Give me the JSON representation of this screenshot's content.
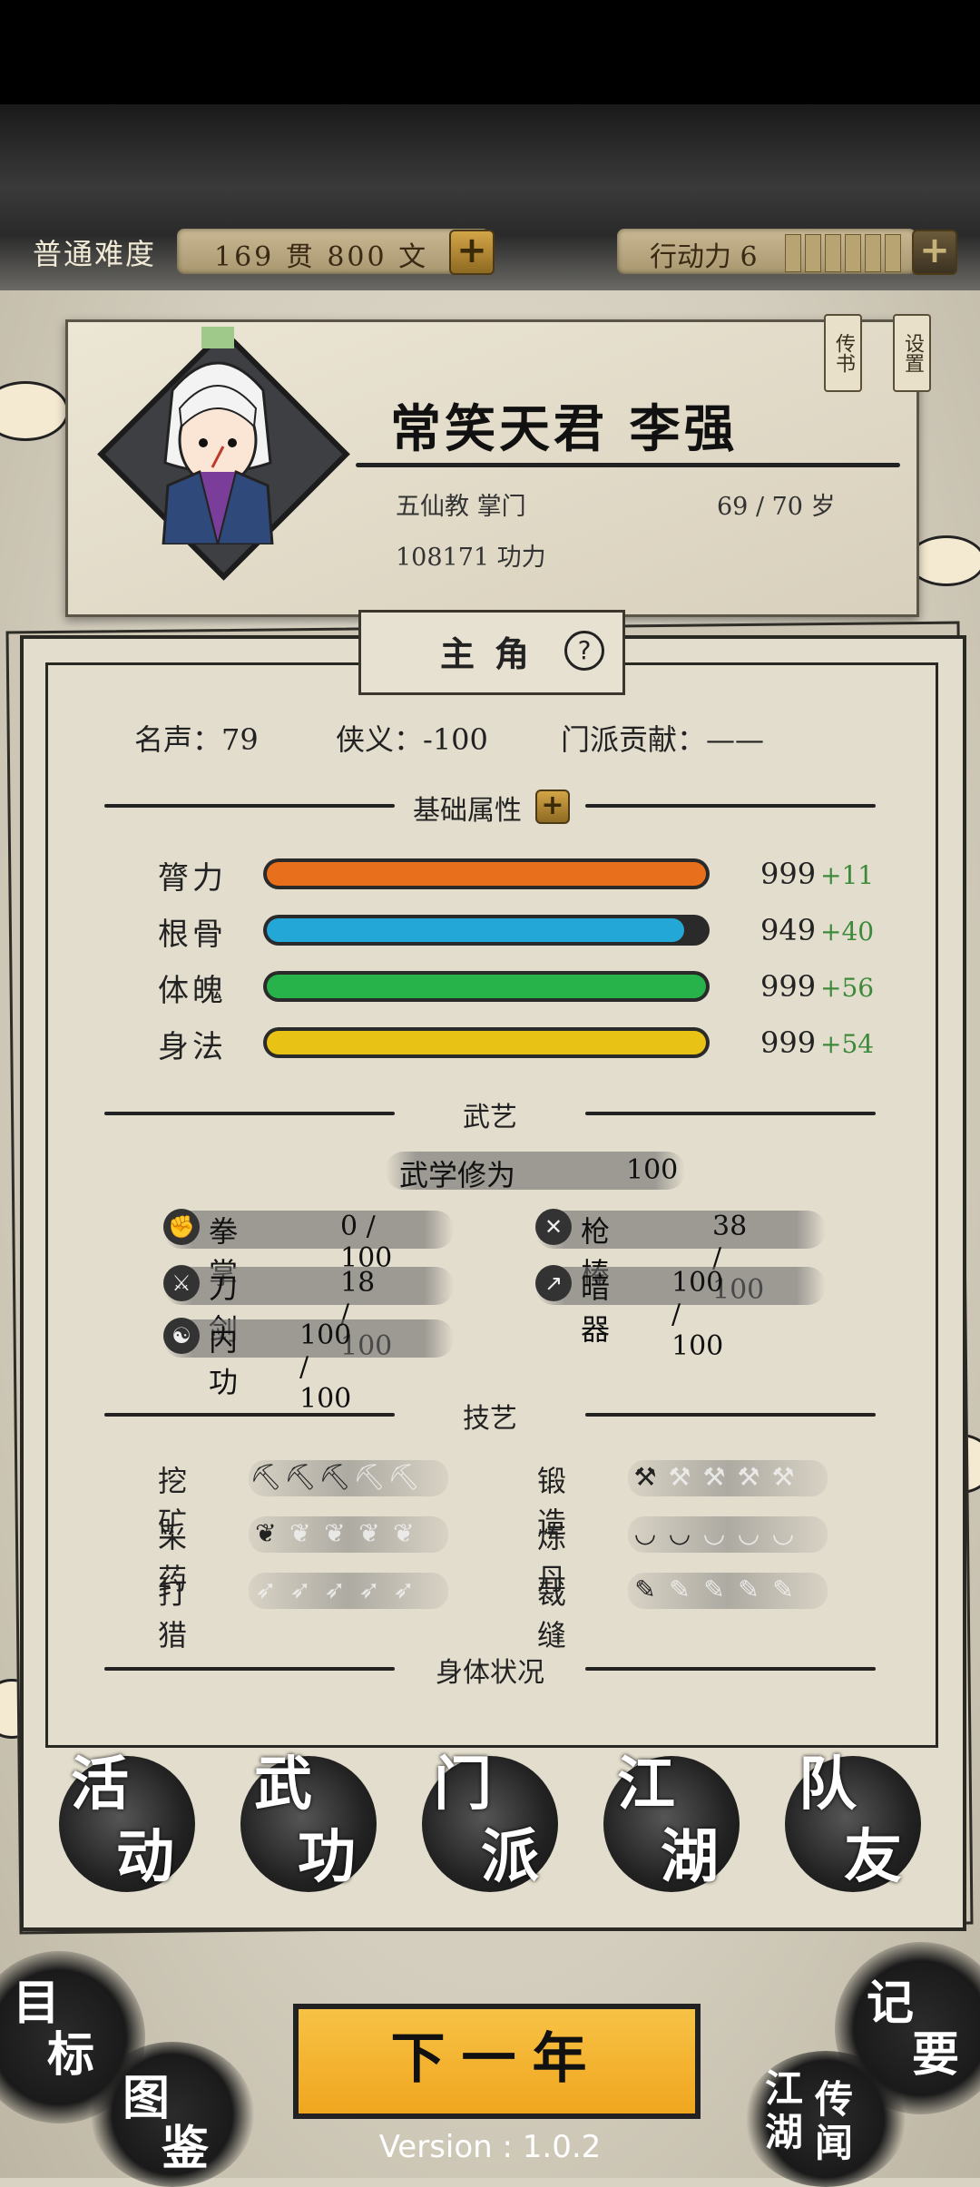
{
  "topbar": {
    "difficulty": "普通难度",
    "money": "169 贯 800 文",
    "action_points": "行动力 6"
  },
  "character": {
    "title_name": "常笑天君 李强",
    "sect_role": "五仙教 掌门",
    "age": "69 / 70 岁",
    "power": "108171 功力"
  },
  "tags": {
    "letter": "传书",
    "settings": "设置"
  },
  "panel": {
    "tab_label": "主角",
    "help_icon": "?",
    "fame": "名声：79",
    "chivalry": "侠义：-100",
    "contribution": "门派贡献：——"
  },
  "sections": {
    "attributes": "基础属性",
    "martial": "武艺",
    "crafts": "技艺",
    "body": "身体状况"
  },
  "attributes": [
    {
      "label": "膂力",
      "value": "999",
      "bonus": "+11",
      "color": "#e8701c",
      "fill": 1.0
    },
    {
      "label": "根骨",
      "value": "949",
      "bonus": "+40",
      "color": "#23a7d6",
      "fill": 0.95
    },
    {
      "label": "体魄",
      "value": "999",
      "bonus": "+56",
      "color": "#27b34a",
      "fill": 1.0
    },
    {
      "label": "身法",
      "value": "999",
      "bonus": "+54",
      "color": "#e8c316",
      "fill": 1.0
    }
  ],
  "martial": {
    "cultivation_label": "武学修为",
    "cultivation_value": "100",
    "skills": [
      {
        "name": "拳掌",
        "value": "0 / 100",
        "icon": "fist-icon"
      },
      {
        "name": "枪棒",
        "value": "38 / 100",
        "icon": "spear-icon"
      },
      {
        "name": "刀剑",
        "value": "18 / 100",
        "icon": "sword-icon"
      },
      {
        "name": "暗器",
        "value": "100 / 100",
        "icon": "dart-icon"
      },
      {
        "name": "内功",
        "value": "100 / 100",
        "icon": "inner-power-icon"
      }
    ]
  },
  "crafts": [
    {
      "name": "挖矿",
      "level": 3,
      "max": 5,
      "icon": "pickaxe-icon"
    },
    {
      "name": "锻造",
      "level": 1,
      "max": 5,
      "icon": "anvil-icon"
    },
    {
      "name": "采药",
      "level": 1,
      "max": 5,
      "icon": "herb-icon"
    },
    {
      "name": "炼丹",
      "level": 2,
      "max": 5,
      "icon": "bowl-icon"
    },
    {
      "name": "打猎",
      "level": 0,
      "max": 5,
      "icon": "bow-icon"
    },
    {
      "name": "裁缝",
      "level": 1,
      "max": 5,
      "icon": "needle-icon"
    }
  ],
  "nav": {
    "activity": "活动",
    "martial": "武功",
    "sect": "门派",
    "jianghu": "江湖",
    "teammates": "队友"
  },
  "bottom": {
    "goals": "目标",
    "codex": "图鉴",
    "next_year": "下一年",
    "notes": "记要",
    "rumors": "江湖传闻",
    "version": "Version : 1.0.2"
  }
}
